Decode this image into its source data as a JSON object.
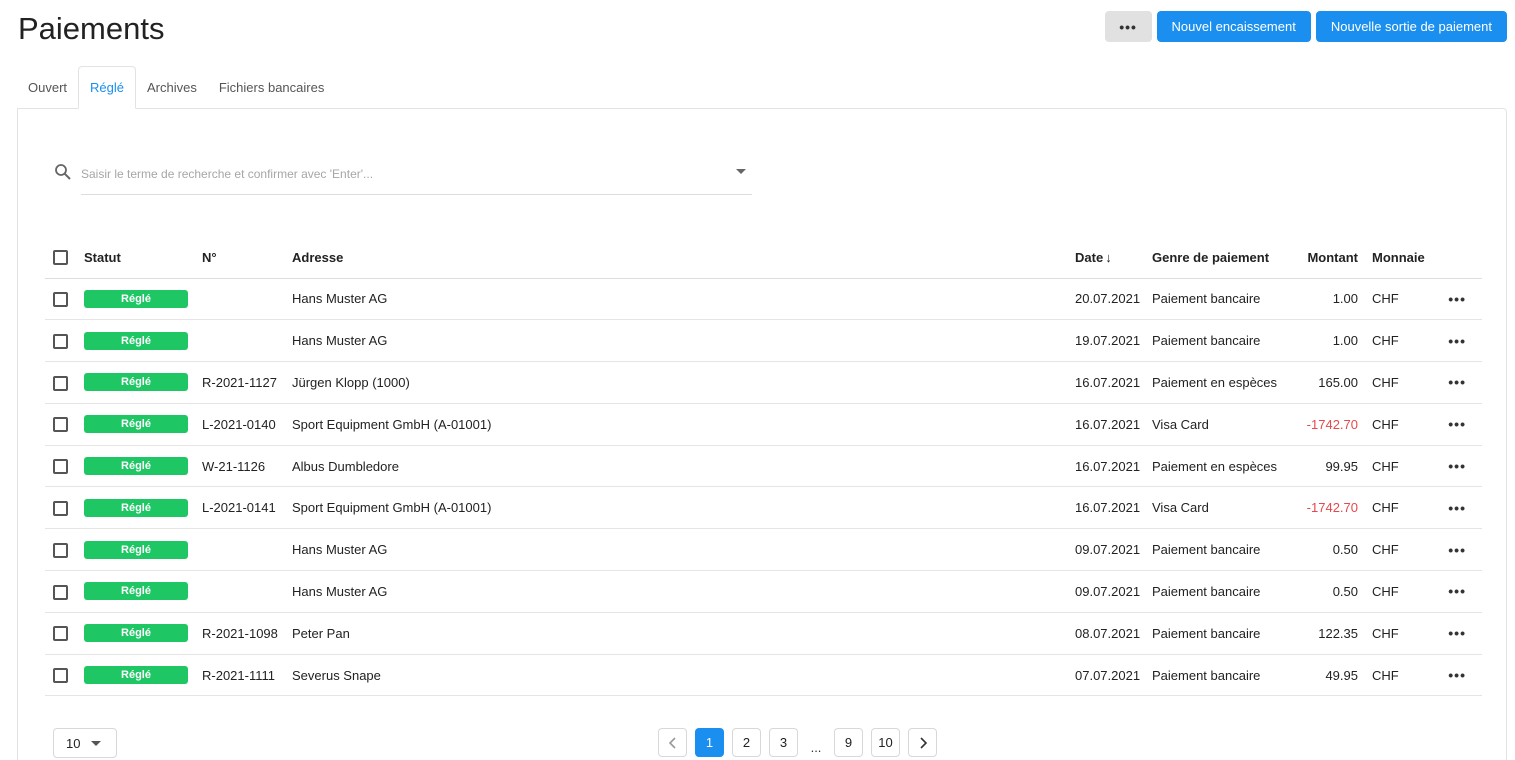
{
  "page": {
    "title": "Paiements"
  },
  "actions": {
    "more_label": "•••",
    "new_receipt": "Nouvel encaissement",
    "new_payment_out": "Nouvelle sortie de paiement"
  },
  "tabs": [
    {
      "label": "Ouvert",
      "active": false
    },
    {
      "label": "Réglé",
      "active": true
    },
    {
      "label": "Archives",
      "active": false
    },
    {
      "label": "Fichiers bancaires",
      "active": false
    }
  ],
  "search": {
    "placeholder": "Saisir le terme de recherche et confirmer avec 'Enter'..."
  },
  "table": {
    "headers": {
      "status": "Statut",
      "number": "N°",
      "address": "Adresse",
      "date": "Date",
      "date_sort": "↓",
      "genre": "Genre de paiement",
      "amount": "Montant",
      "currency": "Monnaie"
    },
    "rows": [
      {
        "status": "Réglé",
        "number": "",
        "address": "Hans Muster AG",
        "date": "20.07.2021",
        "genre": "Paiement bancaire",
        "amount": "1.00",
        "negative": false,
        "currency": "CHF",
        "more": "•••"
      },
      {
        "status": "Réglé",
        "number": "",
        "address": "Hans Muster AG",
        "date": "19.07.2021",
        "genre": "Paiement bancaire",
        "amount": "1.00",
        "negative": false,
        "currency": "CHF",
        "more": "•••"
      },
      {
        "status": "Réglé",
        "number": "R-2021-1127",
        "address": "Jürgen Klopp (1000)",
        "date": "16.07.2021",
        "genre": "Paiement en espèces",
        "amount": "165.00",
        "negative": false,
        "currency": "CHF",
        "more": "•••"
      },
      {
        "status": "Réglé",
        "number": "L-2021-0140",
        "address": "Sport Equipment GmbH (A-01001)",
        "date": "16.07.2021",
        "genre": "Visa Card",
        "amount": "-1742.70",
        "negative": true,
        "currency": "CHF",
        "more": "•••"
      },
      {
        "status": "Réglé",
        "number": "W-21-1126",
        "address": "Albus Dumbledore",
        "date": "16.07.2021",
        "genre": "Paiement en espèces",
        "amount": "99.95",
        "negative": false,
        "currency": "CHF",
        "more": "•••"
      },
      {
        "status": "Réglé",
        "number": "L-2021-0141",
        "address": "Sport Equipment GmbH (A-01001)",
        "date": "16.07.2021",
        "genre": "Visa Card",
        "amount": "-1742.70",
        "negative": true,
        "currency": "CHF",
        "more": "•••"
      },
      {
        "status": "Réglé",
        "number": "",
        "address": "Hans Muster AG",
        "date": "09.07.2021",
        "genre": "Paiement bancaire",
        "amount": "0.50",
        "negative": false,
        "currency": "CHF",
        "more": "•••"
      },
      {
        "status": "Réglé",
        "number": "",
        "address": "Hans Muster AG",
        "date": "09.07.2021",
        "genre": "Paiement bancaire",
        "amount": "0.50",
        "negative": false,
        "currency": "CHF",
        "more": "•••"
      },
      {
        "status": "Réglé",
        "number": "R-2021-1098",
        "address": "Peter Pan",
        "date": "08.07.2021",
        "genre": "Paiement bancaire",
        "amount": "122.35",
        "negative": false,
        "currency": "CHF",
        "more": "•••"
      },
      {
        "status": "Réglé",
        "number": "R-2021-1111",
        "address": "Severus Snape",
        "date": "07.07.2021",
        "genre": "Paiement bancaire",
        "amount": "49.95",
        "negative": false,
        "currency": "CHF",
        "more": "•••"
      }
    ]
  },
  "footer": {
    "page_size": "10",
    "pages": [
      "1",
      "2",
      "3"
    ],
    "ellipsis": "...",
    "last_pages": [
      "9",
      "10"
    ],
    "current_page": "1"
  },
  "colors": {
    "accent": "#1a8fef",
    "status_settled": "#1ec764",
    "negative": "#e5484d"
  },
  "icons": {
    "search": "search-icon",
    "prev": "chevron-left-icon",
    "next": "chevron-right-icon",
    "dropdown": "caret-down-icon"
  }
}
